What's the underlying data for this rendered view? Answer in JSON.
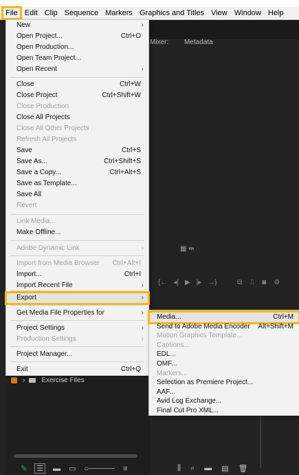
{
  "menubar": {
    "items": [
      "File",
      "Edit",
      "Clip",
      "Sequence",
      "Markers",
      "Graphics and Titles",
      "View",
      "Window",
      "Help"
    ]
  },
  "panels": {
    "mixer_tab": "Mixer:",
    "metadata_tab": "Metadata"
  },
  "file_menu": {
    "items": [
      {
        "label": "New",
        "shortcut": "",
        "submenu": true,
        "disabled": false
      },
      {
        "label": "Open Project...",
        "shortcut": "Ctrl+O",
        "submenu": false,
        "disabled": false
      },
      {
        "label": "Open Production...",
        "shortcut": "",
        "submenu": false,
        "disabled": false
      },
      {
        "label": "Open Team Project...",
        "shortcut": "",
        "submenu": false,
        "disabled": false
      },
      {
        "label": "Open Recent",
        "shortcut": "",
        "submenu": true,
        "disabled": false
      },
      {
        "label": "Close",
        "shortcut": "Ctrl+W",
        "submenu": false,
        "disabled": false
      },
      {
        "label": "Close Project",
        "shortcut": "Ctrl+Shift+W",
        "submenu": false,
        "disabled": false
      },
      {
        "label": "Close Production",
        "shortcut": "",
        "submenu": false,
        "disabled": true
      },
      {
        "label": "Close All Projects",
        "shortcut": "",
        "submenu": false,
        "disabled": false
      },
      {
        "label": "Close All Other Projects",
        "shortcut": "",
        "submenu": false,
        "disabled": true
      },
      {
        "label": "Refresh All Projects",
        "shortcut": "",
        "submenu": false,
        "disabled": true
      },
      {
        "label": "Save",
        "shortcut": "Ctrl+S",
        "submenu": false,
        "disabled": false
      },
      {
        "label": "Save As...",
        "shortcut": "Ctrl+Shift+S",
        "submenu": false,
        "disabled": false
      },
      {
        "label": "Save a Copy...",
        "shortcut": "Ctrl+Alt+S",
        "submenu": false,
        "disabled": false
      },
      {
        "label": "Save as Template...",
        "shortcut": "",
        "submenu": false,
        "disabled": false
      },
      {
        "label": "Save All",
        "shortcut": "",
        "submenu": false,
        "disabled": false
      },
      {
        "label": "Revert",
        "shortcut": "",
        "submenu": false,
        "disabled": true
      },
      {
        "label": "Link Media...",
        "shortcut": "",
        "submenu": false,
        "disabled": true
      },
      {
        "label": "Make Offline...",
        "shortcut": "",
        "submenu": false,
        "disabled": false
      },
      {
        "label": "Adobe Dynamic Link",
        "shortcut": "",
        "submenu": true,
        "disabled": true
      },
      {
        "label": "Import from Media Browser",
        "shortcut": "Ctrl+Alt+I",
        "submenu": false,
        "disabled": true
      },
      {
        "label": "Import...",
        "shortcut": "Ctrl+I",
        "submenu": false,
        "disabled": false
      },
      {
        "label": "Import Recent File",
        "shortcut": "",
        "submenu": true,
        "disabled": false
      },
      {
        "label": "Export",
        "shortcut": "",
        "submenu": true,
        "disabled": false
      },
      {
        "label": "Get Media File Properties for",
        "shortcut": "",
        "submenu": true,
        "disabled": false
      },
      {
        "label": "Project Settings",
        "shortcut": "",
        "submenu": true,
        "disabled": false
      },
      {
        "label": "Production Settings",
        "shortcut": "",
        "submenu": true,
        "disabled": true
      },
      {
        "label": "Project Manager...",
        "shortcut": "",
        "submenu": false,
        "disabled": false
      },
      {
        "label": "Exit",
        "shortcut": "Ctrl+Q",
        "submenu": false,
        "disabled": false
      }
    ]
  },
  "export_submenu": {
    "items": [
      {
        "label": "Media...",
        "shortcut": "Ctrl+M",
        "disabled": false
      },
      {
        "label": "Send to Adobe Media Encoder",
        "shortcut": "Alt+Shift+M",
        "disabled": false
      },
      {
        "label": "Motion Graphics Template...",
        "shortcut": "",
        "disabled": true
      },
      {
        "label": "Captions...",
        "shortcut": "",
        "disabled": true
      },
      {
        "label": "EDL...",
        "shortcut": "",
        "disabled": false
      },
      {
        "label": "OMF...",
        "shortcut": "",
        "disabled": false
      },
      {
        "label": "Markers...",
        "shortcut": "",
        "disabled": true
      },
      {
        "label": "Selection as Premiere Project...",
        "shortcut": "",
        "disabled": false
      },
      {
        "label": "AAF...",
        "shortcut": "",
        "disabled": false
      },
      {
        "label": "Avid Log Exchange...",
        "shortcut": "",
        "disabled": false
      },
      {
        "label": "Final Cut Pro XML...",
        "shortcut": "",
        "disabled": false
      }
    ]
  },
  "project_panel": {
    "folder_label": "Exercise Files"
  },
  "colors": {
    "highlight": "#f5b80f",
    "label_orange": "#d77a17",
    "pen_green": "#3dba4e"
  }
}
